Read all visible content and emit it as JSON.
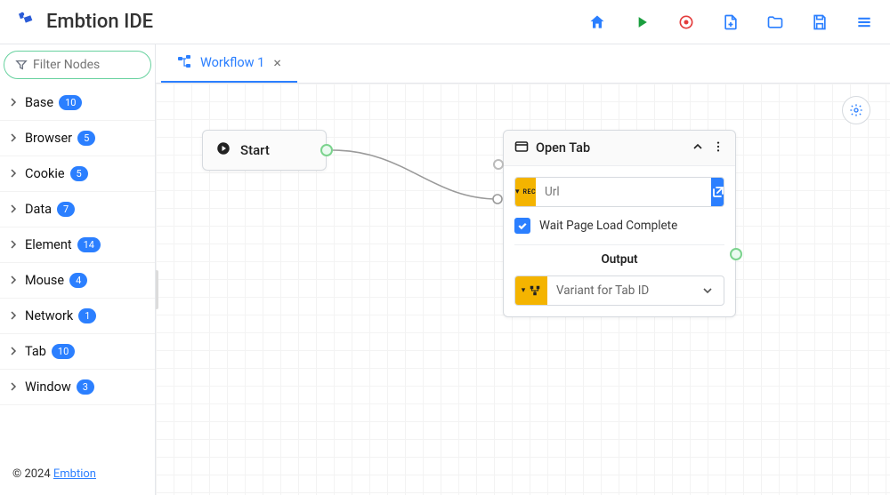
{
  "app": {
    "title": "Embtion IDE"
  },
  "toolbar": {
    "home": "home",
    "run": "run",
    "stop": "stop",
    "new_file": "new-file",
    "open_folder": "open-folder",
    "save": "save",
    "menu": "menu"
  },
  "sidebar": {
    "filter_placeholder": "Filter Nodes",
    "items": [
      {
        "label": "Base",
        "count": "10"
      },
      {
        "label": "Browser",
        "count": "5"
      },
      {
        "label": "Cookie",
        "count": "5"
      },
      {
        "label": "Data",
        "count": "7"
      },
      {
        "label": "Element",
        "count": "14"
      },
      {
        "label": "Mouse",
        "count": "4"
      },
      {
        "label": "Network",
        "count": "1"
      },
      {
        "label": "Tab",
        "count": "10"
      },
      {
        "label": "Window",
        "count": "3"
      }
    ],
    "footer_prefix": "© 2024 ",
    "footer_link": "Embtion"
  },
  "tabs": [
    {
      "label": "Workflow 1",
      "icon": "workflow-icon"
    }
  ],
  "canvas": {
    "start_node": {
      "label": "Start"
    },
    "open_tab_node": {
      "title": "Open Tab",
      "url_placeholder": "Url",
      "wait_label": "Wait Page Load Complete",
      "wait_checked": true,
      "output_label": "Output",
      "variant_placeholder": "Variant for Tab ID"
    }
  }
}
